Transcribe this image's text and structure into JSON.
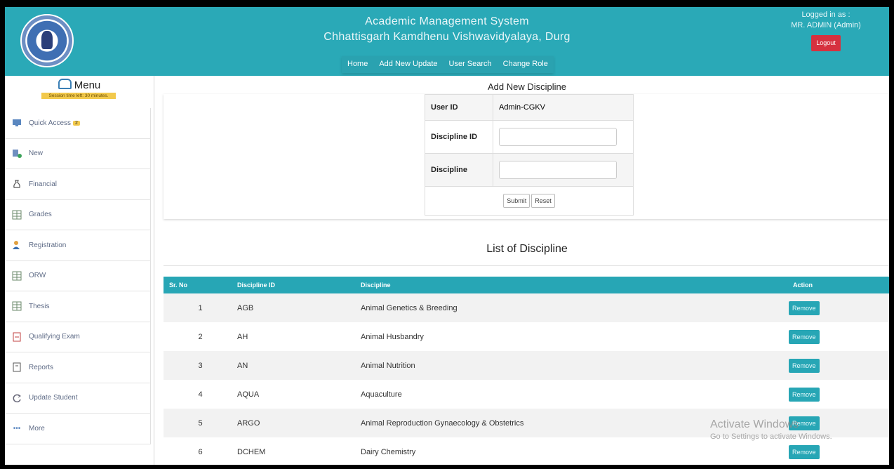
{
  "header": {
    "title_line1": "Academic Management System",
    "title_line2": "Chhattisgarh Kamdhenu Vishwavidyalaya, Durg",
    "nav": [
      "Home",
      "Add New Update",
      "User Search",
      "Change Role"
    ],
    "logged_in_label": "Logged in as :",
    "user": "MR. ADMIN (Admin)",
    "logout": "Logout",
    "logo_icon": "university-seal-icon"
  },
  "sidebar": {
    "title": "Menu",
    "session": "Session time left: 30 minutes.",
    "items": [
      {
        "label": "Quick Access",
        "icon": "monitor-icon",
        "badge": "2"
      },
      {
        "label": "New",
        "icon": "new-user-icon"
      },
      {
        "label": "Financial",
        "icon": "money-bag-icon"
      },
      {
        "label": "Grades",
        "icon": "grid-icon"
      },
      {
        "label": "Registration",
        "icon": "person-icon"
      },
      {
        "label": "ORW",
        "icon": "grid-icon"
      },
      {
        "label": "Thesis",
        "icon": "grid-icon"
      },
      {
        "label": "Qualifying Exam",
        "icon": "document-icon"
      },
      {
        "label": "Reports",
        "icon": "report-icon"
      },
      {
        "label": "Update Student",
        "icon": "refresh-icon"
      },
      {
        "label": "More",
        "icon": "dots-icon"
      }
    ]
  },
  "form": {
    "title": "Add New Discipline",
    "user_id_label": "User ID",
    "user_id_value": "Admin-CGKV",
    "discipline_id_label": "Discipline ID",
    "discipline_label": "Discipline",
    "submit": "Submit",
    "reset": "Reset"
  },
  "list": {
    "title": "List of Discipline",
    "headers": [
      "Sr. No",
      "Discipline ID",
      "Discipline",
      "Action"
    ],
    "rows": [
      {
        "sno": "1",
        "id": "AGB",
        "name": "Animal Genetics & Breeding",
        "action": "Remove"
      },
      {
        "sno": "2",
        "id": "AH",
        "name": "Animal Husbandry",
        "action": "Remove"
      },
      {
        "sno": "3",
        "id": "AN",
        "name": "Animal Nutrition",
        "action": "Remove"
      },
      {
        "sno": "4",
        "id": "AQUA",
        "name": "Aquaculture",
        "action": "Remove"
      },
      {
        "sno": "5",
        "id": "ARGO",
        "name": "Animal Reproduction Gynaecology & Obstetrics",
        "action": "Remove"
      },
      {
        "sno": "6",
        "id": "DCHEM",
        "name": "Dairy Chemistry",
        "action": "Remove"
      }
    ]
  },
  "watermark": {
    "line1": "Activate Windows",
    "line2": "Go to Settings to activate Windows."
  },
  "colors": {
    "header_bg": "#2aa9b7",
    "logout_bg": "#d6313f",
    "badge_bg": "#f2c94c"
  }
}
